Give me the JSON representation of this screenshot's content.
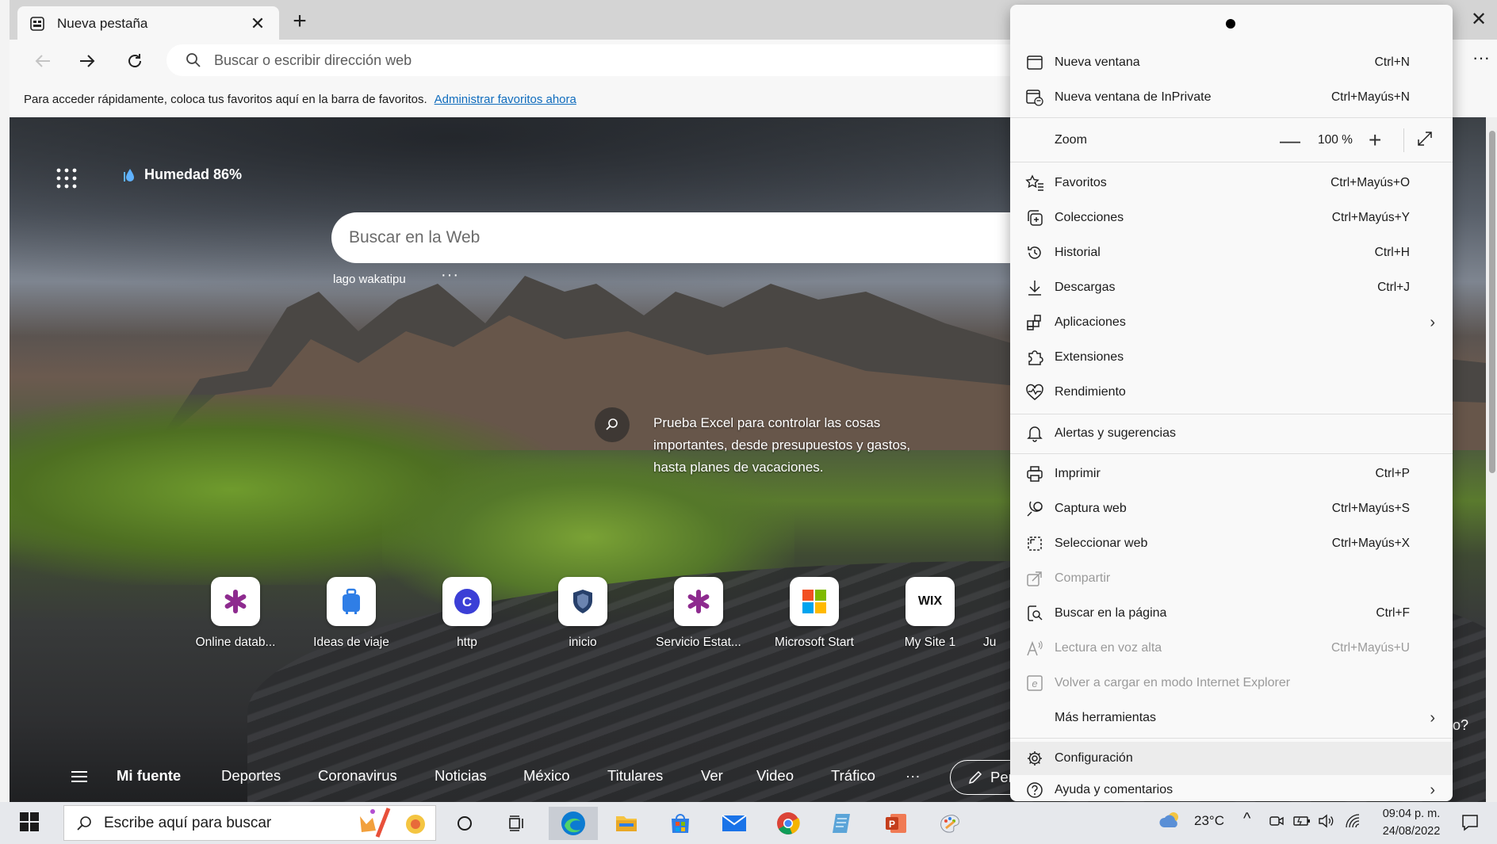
{
  "browser": {
    "tab_title": "Nueva pestaña",
    "address_placeholder": "Buscar o escribir dirección web",
    "favbar_text": "Para acceder rápidamente, coloca tus favoritos aquí en la barra de favoritos.",
    "favbar_link": "Administrar favoritos ahora"
  },
  "newtab": {
    "weather": "Humedad 86%",
    "search_placeholder": "Buscar en la Web",
    "bg_caption": "lago wakatipu",
    "bg_more": "···",
    "promo": "Prueba Excel para controlar las cosas importantes, desde presupuestos y gastos, hasta planes de vacaciones.",
    "tiles": [
      {
        "label": "Online datab...",
        "icon": "asterisk-purple-icon"
      },
      {
        "label": "Ideas de viaje",
        "icon": "suitcase-icon"
      },
      {
        "label": "http",
        "icon": "c-logo-icon"
      },
      {
        "label": "inicio",
        "icon": "shield-crest-icon"
      },
      {
        "label": "Servicio Estat...",
        "icon": "asterisk-purple-icon"
      },
      {
        "label": "Microsoft Start",
        "icon": "microsoft-logo-icon"
      },
      {
        "label": "My Site 1",
        "icon": "wix-logo-icon"
      },
      {
        "label": "Ju",
        "icon": ""
      }
    ],
    "wix_text": "WIX",
    "c_text": "C",
    "feed": {
      "items": [
        "Mi fuente",
        "Deportes",
        "Coronavirus",
        "Noticias",
        "México",
        "Titulares",
        "Ver",
        "Video",
        "Tráfico",
        "···"
      ],
      "personalize": "Per"
    },
    "stray_text": "o?"
  },
  "menu": {
    "items": [
      {
        "label": "Nueva ventana",
        "shortcut": "Ctrl+N",
        "icon": "window-icon"
      },
      {
        "label": "Nueva ventana de InPrivate",
        "shortcut": "Ctrl+Mayús+N",
        "icon": "inprivate-icon"
      },
      {
        "label": "Zoom",
        "value": "100 %",
        "icon": ""
      },
      {
        "label": "Favoritos",
        "shortcut": "Ctrl+Mayús+O",
        "icon": "favorites-icon"
      },
      {
        "label": "Colecciones",
        "shortcut": "Ctrl+Mayús+Y",
        "icon": "collections-icon"
      },
      {
        "label": "Historial",
        "shortcut": "Ctrl+H",
        "icon": "history-icon"
      },
      {
        "label": "Descargas",
        "shortcut": "Ctrl+J",
        "icon": "download-icon"
      },
      {
        "label": "Aplicaciones",
        "shortcut": "",
        "icon": "apps-icon"
      },
      {
        "label": "Extensiones",
        "shortcut": "",
        "icon": "extensions-icon"
      },
      {
        "label": "Rendimiento",
        "shortcut": "",
        "icon": "performance-icon"
      },
      {
        "label": "Alertas y sugerencias",
        "shortcut": "",
        "icon": "bell-icon"
      },
      {
        "label": "Imprimir",
        "shortcut": "Ctrl+P",
        "icon": "print-icon"
      },
      {
        "label": "Captura web",
        "shortcut": "Ctrl+Mayús+S",
        "icon": "web-capture-icon"
      },
      {
        "label": "Seleccionar web",
        "shortcut": "Ctrl+Mayús+X",
        "icon": "web-select-icon"
      },
      {
        "label": "Compartir",
        "shortcut": "",
        "icon": "share-icon"
      },
      {
        "label": "Buscar en la página",
        "shortcut": "Ctrl+F",
        "icon": "find-icon"
      },
      {
        "label": "Lectura en voz alta",
        "shortcut": "Ctrl+Mayús+U",
        "icon": "read-aloud-icon"
      },
      {
        "label": "Volver a cargar en modo Internet Explorer",
        "shortcut": "",
        "icon": "ie-mode-icon"
      },
      {
        "label": "Más herramientas",
        "shortcut": "",
        "icon": ""
      },
      {
        "label": "Configuración",
        "shortcut": "",
        "icon": "gear-icon"
      },
      {
        "label": "Ayuda y comentarios",
        "shortcut": "",
        "icon": "help-icon"
      }
    ],
    "zoom_minus": "—",
    "zoom_plus": "+"
  },
  "taskbar": {
    "search_placeholder": "Escribe aquí para buscar",
    "temperature": "23°C",
    "time": "09:04 p. m.",
    "date": "24/08/2022"
  },
  "colors": {
    "accent_link": "#0f6cbd",
    "chrome_bg": "#f7f7f7",
    "taskbar_bg": "#e6e8ec"
  }
}
